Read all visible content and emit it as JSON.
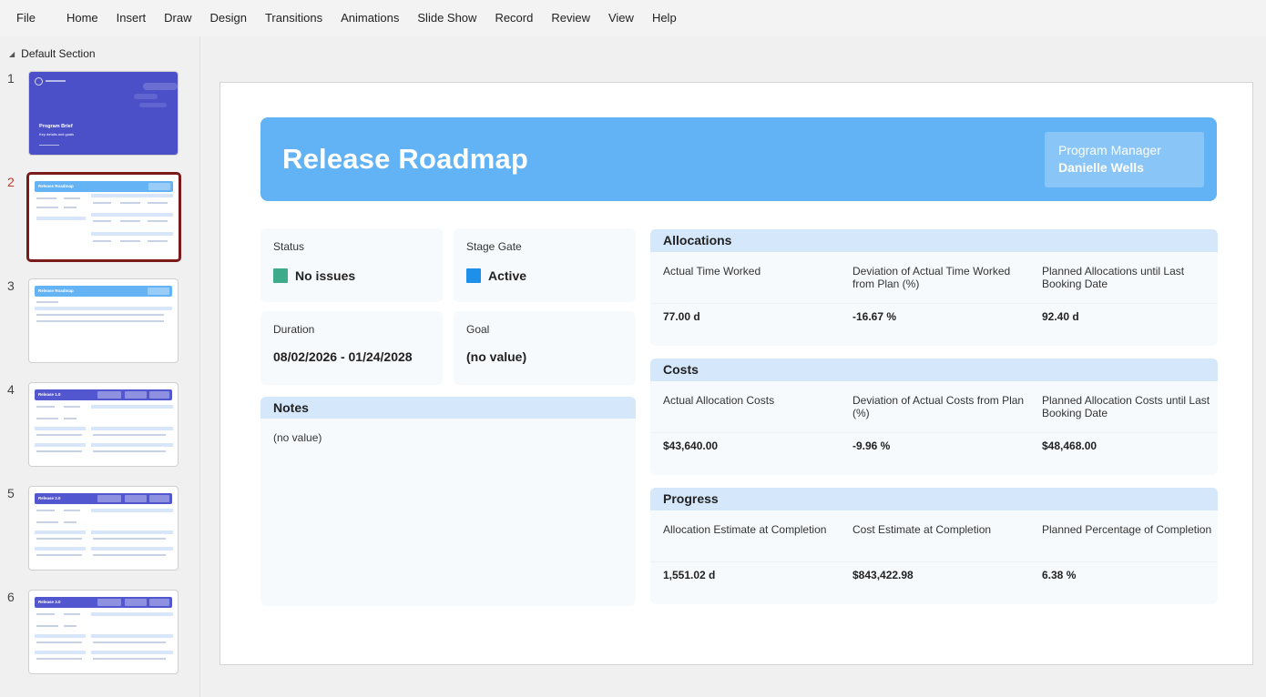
{
  "menu": [
    "File",
    "Home",
    "Insert",
    "Draw",
    "Design",
    "Transitions",
    "Animations",
    "Slide Show",
    "Record",
    "Review",
    "View",
    "Help"
  ],
  "sidebar": {
    "section": "Default Section",
    "slides": [
      {
        "num": "1",
        "title": "Program Brief",
        "subtitle": "Key details and goals"
      },
      {
        "num": "2",
        "title": "Release Roadmap"
      },
      {
        "num": "3",
        "title": "Release Roadmap"
      },
      {
        "num": "4",
        "title": "Release 1.0"
      },
      {
        "num": "5",
        "title": "Release 2.0"
      },
      {
        "num": "6",
        "title": "Release 3.0"
      }
    ]
  },
  "slide": {
    "title": "Release Roadmap",
    "pm_label": "Program Manager",
    "pm_name": "Danielle Wells",
    "status": {
      "label": "Status",
      "value": "No issues",
      "color": "#3daa8a"
    },
    "stage_gate": {
      "label": "Stage Gate",
      "value": "Active",
      "color": "#1e90ea"
    },
    "duration": {
      "label": "Duration",
      "value": "08/02/2026 - 01/24/2028"
    },
    "goal": {
      "label": "Goal",
      "value": "(no value)"
    },
    "notes": {
      "title": "Notes",
      "value": "(no value)"
    },
    "allocations": {
      "title": "Allocations",
      "metrics": [
        {
          "label": "Actual Time Worked",
          "value": "77.00 d"
        },
        {
          "label": "Deviation of Actual Time Worked from Plan (%)",
          "value": "-16.67 %"
        },
        {
          "label": "Planned Allocations until Last Booking Date",
          "value": "92.40 d"
        }
      ]
    },
    "costs": {
      "title": "Costs",
      "metrics": [
        {
          "label": "Actual Allocation Costs",
          "value": "$43,640.00"
        },
        {
          "label": "Deviation of Actual Costs from Plan (%)",
          "value": "-9.96 %"
        },
        {
          "label": "Planned Allocation Costs until Last Booking Date",
          "value": "$48,468.00"
        }
      ]
    },
    "progress": {
      "title": "Progress",
      "metrics": [
        {
          "label": "Allocation Estimate at Completion",
          "value": "1,551.02 d"
        },
        {
          "label": "Cost Estimate at Completion",
          "value": "$843,422.98"
        },
        {
          "label": "Planned Percentage of Completion",
          "value": "6.38 %"
        }
      ]
    }
  }
}
